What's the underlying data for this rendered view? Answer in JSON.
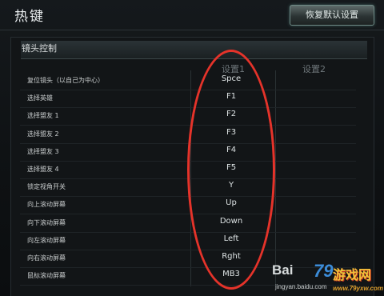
{
  "header": {
    "title": "热键",
    "restore_defaults_label": "恢复默认设置"
  },
  "section": {
    "title": "镜头控制",
    "columns": [
      "设置1",
      "设置2"
    ]
  },
  "rows": [
    {
      "label": "复位镜头（以自己为中心）",
      "key1": "Spce",
      "key2": ""
    },
    {
      "label": "选择英雄",
      "key1": "F1",
      "key2": ""
    },
    {
      "label": "选择盟友 1",
      "key1": "F2",
      "key2": ""
    },
    {
      "label": "选择盟友 2",
      "key1": "F3",
      "key2": ""
    },
    {
      "label": "选择盟友 3",
      "key1": "F4",
      "key2": ""
    },
    {
      "label": "选择盟友 4",
      "key1": "F5",
      "key2": ""
    },
    {
      "label": "锁定视角开关",
      "key1": "Y",
      "key2": ""
    },
    {
      "label": "向上滚动屏幕",
      "key1": "Up",
      "key2": ""
    },
    {
      "label": "向下滚动屏幕",
      "key1": "Down",
      "key2": ""
    },
    {
      "label": "向左滚动屏幕",
      "key1": "Left",
      "key2": ""
    },
    {
      "label": "向右滚动屏幕",
      "key1": "Rght",
      "key2": ""
    },
    {
      "label": "鼠标滚动屏幕",
      "key1": "MB3",
      "key2": ""
    }
  ],
  "watermark": {
    "baidu": "Bai",
    "baidu_sub": "jingyan.baidu.com",
    "site_logo": "79",
    "site_name": "游戏网",
    "site_url": "www.79yxw.com"
  },
  "colors": {
    "annotation_oval": "#e5332a",
    "button_glow": "#6f8a86"
  }
}
